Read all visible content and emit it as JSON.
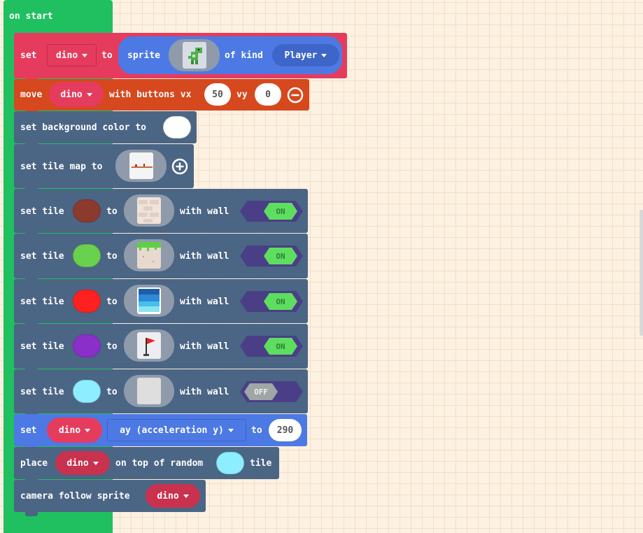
{
  "colors": {
    "on_start": "#20bf60",
    "sprites": "#e53c5e",
    "controller": "#d6481d",
    "scene": "#4b6584",
    "sprite_prop": "#4d79e4",
    "dino_dropdown": "#c8324f",
    "tile_colors": [
      "#8b3a2e",
      "#6ad14f",
      "#ff2020",
      "#8a2fc7",
      "#8deeff"
    ],
    "background_color": "#ffffff"
  },
  "on_start": {
    "label": "on start"
  },
  "set_sprite": {
    "set": "set",
    "var": "dino",
    "to": "to",
    "sprite": "sprite",
    "of_kind": "of kind",
    "kind": "Player",
    "image": "dino-sprite"
  },
  "move": {
    "move": "move",
    "var": "dino",
    "with_buttons": "with buttons vx",
    "vx": "50",
    "vy_label": "vy",
    "vy": "0",
    "remove_icon": "minus-circle-icon"
  },
  "background": {
    "label": "set background color to"
  },
  "tilemap": {
    "label": "set tile map to",
    "add_icon": "plus-circle-icon"
  },
  "tiles": [
    {
      "set": "set tile",
      "to": "to",
      "with_wall": "with wall",
      "wall": "ON",
      "image": "brick-wall"
    },
    {
      "set": "set tile",
      "to": "to",
      "with_wall": "with wall",
      "wall": "ON",
      "image": "grass-dirt"
    },
    {
      "set": "set tile",
      "to": "to",
      "with_wall": "with wall",
      "wall": "ON",
      "image": "water"
    },
    {
      "set": "set tile",
      "to": "to",
      "with_wall": "with wall",
      "wall": "ON",
      "image": "red-flag"
    },
    {
      "set": "set tile",
      "to": "to",
      "with_wall": "with wall",
      "wall": "OFF",
      "image": "empty"
    }
  ],
  "set_prop": {
    "set": "set",
    "var": "dino",
    "prop": "ay (acceleration y)",
    "to": "to",
    "value": "290"
  },
  "place": {
    "place": "place",
    "var": "dino",
    "on_top": "on top of random",
    "tile": "tile"
  },
  "camera": {
    "label": "camera follow sprite",
    "var": "dino"
  }
}
